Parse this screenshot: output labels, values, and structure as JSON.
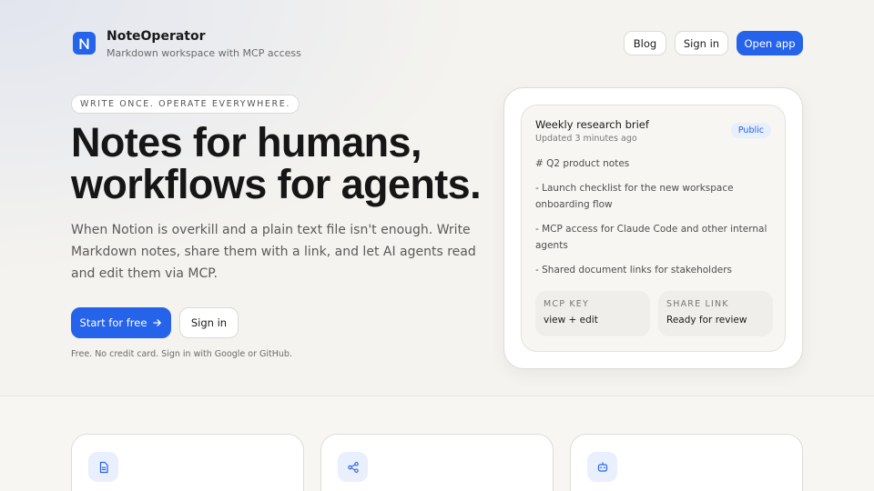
{
  "brand": {
    "name": "NoteOperator",
    "tagline": "Markdown workspace with MCP access",
    "logo_letter": "N",
    "accent": "#2563eb"
  },
  "nav": {
    "blog": "Blog",
    "sign_in": "Sign in",
    "open_app": "Open app"
  },
  "hero": {
    "eyebrow": "WRITE ONCE. OPERATE EVERYWHERE.",
    "headline_line1": "Notes for humans,",
    "headline_line2": "workflows for agents.",
    "lede": "When Notion is overkill and a plain text file isn't enough. Write Markdown notes, share them with a link, and let AI agents read and edit them via MCP.",
    "cta_primary": "Start for free",
    "cta_primary_icon": "arrow-right-icon",
    "cta_secondary": "Sign in",
    "fineprint": "Free. No credit card. Sign in with Google or GitHub."
  },
  "preview": {
    "title": "Weekly research brief",
    "updated": "Updated 3 minutes ago",
    "badge": "Public",
    "lines": [
      "# Q2 product notes",
      "- Launch checklist for the new workspace onboarding flow",
      "- MCP access for Claude Code and other internal agents",
      "- Shared document links for stakeholders"
    ],
    "chips": [
      {
        "label": "MCP KEY",
        "value": "view + edit"
      },
      {
        "label": "SHARE LINK",
        "value": "Ready for review"
      }
    ]
  },
  "features": [
    {
      "icon": "document-icon"
    },
    {
      "icon": "share-icon"
    },
    {
      "icon": "robot-icon"
    }
  ]
}
